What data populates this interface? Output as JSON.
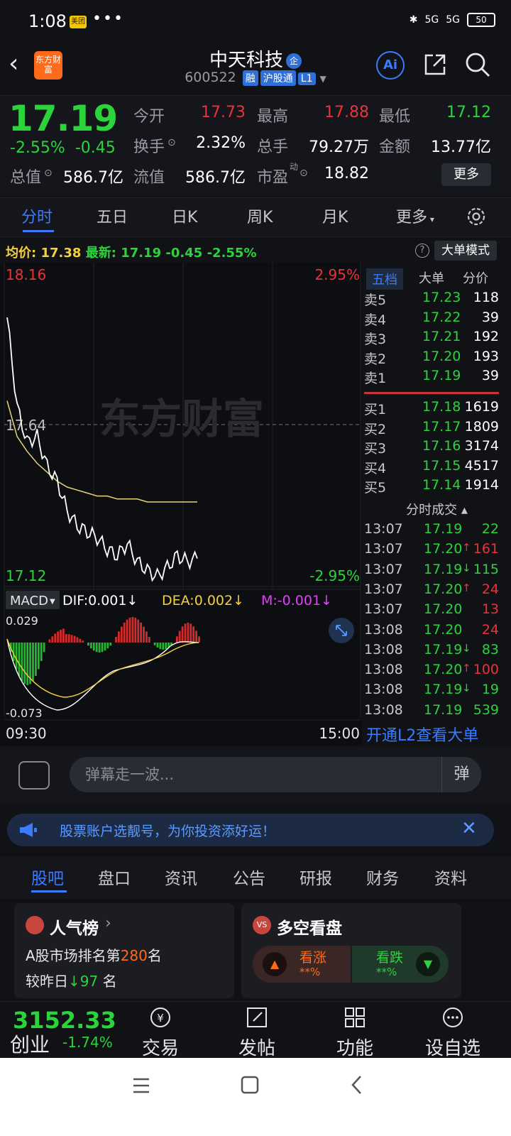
{
  "status_bar": {
    "time": "1:08",
    "app_badge": "美团",
    "dots": "•••",
    "sig1": "5G",
    "sig2": "5G",
    "battery": "50"
  },
  "header": {
    "logo_text": "东方财富",
    "title": "中天科技",
    "qi_badge": "企",
    "code": "600522",
    "tag_rong": "融",
    "tag_hgt": "沪股通",
    "tag_l1": "L1",
    "ai_label": "Ai"
  },
  "quote": {
    "price": "17.19",
    "change_pct": "-2.55%",
    "change_amt": "-0.45",
    "open_label": "今开",
    "open": "17.73",
    "high_label": "最高",
    "high": "17.88",
    "low_label": "最低",
    "low": "17.12",
    "turnover_label": "换手",
    "turnover": "2.32%",
    "volume_label": "总手",
    "volume": "79.27万",
    "amount_label": "金额",
    "amount": "13.77亿",
    "mktcap_label": "总值",
    "mktcap": "586.7亿",
    "float_label": "流值",
    "float": "586.7亿",
    "pe_label": "市盈",
    "pe_sup": "动",
    "pe": "18.82",
    "more_button": "更多"
  },
  "tabs": [
    "分时",
    "五日",
    "日K",
    "周K",
    "月K",
    "更多"
  ],
  "info_bar": {
    "avg_label": "均价:",
    "avg": "17.38",
    "latest_label": "最新:",
    "latest": "17.19",
    "chg": "-0.45",
    "chg_pct": "-2.55%",
    "help": "?",
    "mode_button": "大单模式"
  },
  "chart": {
    "high_price": "18.16",
    "high_pct": "2.95%",
    "mid_price": "17.64",
    "low_price": "17.12",
    "low_pct": "-2.95%",
    "watermark": "东方财富",
    "macd_label": "MACD",
    "dif": "DIF:0.001↓",
    "dea": "DEA:0.002↓",
    "m": "M:-0.001↓",
    "macd_max": "0.029",
    "macd_min": "-0.073",
    "time_start": "09:30",
    "time_end": "15:00"
  },
  "chart_data": {
    "type": "line",
    "ylim": [
      17.12,
      18.16
    ],
    "ref_price": 17.64,
    "series": [
      {
        "name": "最新",
        "values": [
          18.0,
          17.7,
          17.58,
          17.6,
          17.5,
          17.45,
          17.35,
          17.3,
          17.28,
          17.26,
          17.22,
          17.2,
          17.24,
          17.18,
          17.15,
          17.13,
          17.16,
          17.2,
          17.18,
          17.19
        ]
      },
      {
        "name": "均价",
        "values": [
          17.72,
          17.6,
          17.55,
          17.51,
          17.48,
          17.45,
          17.43,
          17.42,
          17.41,
          17.4,
          17.4,
          17.39,
          17.39,
          17.39,
          17.38,
          17.38,
          17.38,
          17.38,
          17.38,
          17.38
        ]
      }
    ]
  },
  "orderbook": {
    "tabs": [
      "五档",
      "大单",
      "分价"
    ],
    "asks": [
      {
        "label": "卖5",
        "price": "17.23",
        "vol": "118"
      },
      {
        "label": "卖4",
        "price": "17.22",
        "vol": "39"
      },
      {
        "label": "卖3",
        "price": "17.21",
        "vol": "192"
      },
      {
        "label": "卖2",
        "price": "17.20",
        "vol": "193"
      },
      {
        "label": "卖1",
        "price": "17.19",
        "vol": "39"
      }
    ],
    "bids": [
      {
        "label": "买1",
        "price": "17.18",
        "vol": "1619"
      },
      {
        "label": "买2",
        "price": "17.17",
        "vol": "1809"
      },
      {
        "label": "买3",
        "price": "17.16",
        "vol": "3174"
      },
      {
        "label": "买4",
        "price": "17.15",
        "vol": "4517"
      },
      {
        "label": "买5",
        "price": "17.14",
        "vol": "1914"
      }
    ],
    "ticks_title": "分时成交 ▴",
    "ticks": [
      {
        "time": "13:07",
        "price": "17.19",
        "arrow": "",
        "vol": "22",
        "pc": "green",
        "vc": "green"
      },
      {
        "time": "13:07",
        "price": "17.20",
        "arrow": "↑",
        "vol": "161",
        "pc": "green",
        "vc": "red"
      },
      {
        "time": "13:07",
        "price": "17.19",
        "arrow": "↓",
        "vol": "115",
        "pc": "green",
        "vc": "green"
      },
      {
        "time": "13:07",
        "price": "17.20",
        "arrow": "↑",
        "vol": "24",
        "pc": "green",
        "vc": "red"
      },
      {
        "time": "13:07",
        "price": "17.20",
        "arrow": "",
        "vol": "13",
        "pc": "green",
        "vc": "red"
      },
      {
        "time": "13:08",
        "price": "17.20",
        "arrow": "",
        "vol": "24",
        "pc": "green",
        "vc": "red"
      },
      {
        "time": "13:08",
        "price": "17.19",
        "arrow": "↓",
        "vol": "83",
        "pc": "green",
        "vc": "green"
      },
      {
        "time": "13:08",
        "price": "17.20",
        "arrow": "↑",
        "vol": "100",
        "pc": "green",
        "vc": "red"
      },
      {
        "time": "13:08",
        "price": "17.19",
        "arrow": "↓",
        "vol": "19",
        "pc": "green",
        "vc": "green"
      },
      {
        "time": "13:08",
        "price": "17.19",
        "arrow": "",
        "vol": "539",
        "pc": "green",
        "vc": "green"
      }
    ],
    "l2_link": "开通L2查看大单"
  },
  "danmaku": {
    "placeholder": "弹幕走一波...",
    "button": "弹"
  },
  "banner": {
    "text": "股票账户选靓号，为你投资添好运！"
  },
  "bottom_tabs": [
    "股吧",
    "盘口",
    "资讯",
    "公告",
    "研报",
    "财务",
    "资料"
  ],
  "cards": {
    "popular": {
      "title": "人气榜",
      "line1_prefix": "A股市场排名第",
      "rank": "280",
      "line1_suffix": "名",
      "line2_prefix": "较昨日",
      "delta": "97",
      "line2_suffix": "名"
    },
    "bullbear": {
      "title": "多空看盘",
      "bull_label": "看涨",
      "bull_pct": "**%",
      "bear_label": "看跌",
      "bear_pct": "**%"
    }
  },
  "bottom_nav": {
    "index_value": "3152.33",
    "index_name": "创业",
    "index_chg": "-1.74%",
    "items": [
      "交易",
      "发帖",
      "功能",
      "设自选"
    ]
  },
  "colors": {
    "up": "#e8333a",
    "down": "#2bd43a",
    "accent": "#3a7bff",
    "avg_line": "#e8d27a"
  }
}
